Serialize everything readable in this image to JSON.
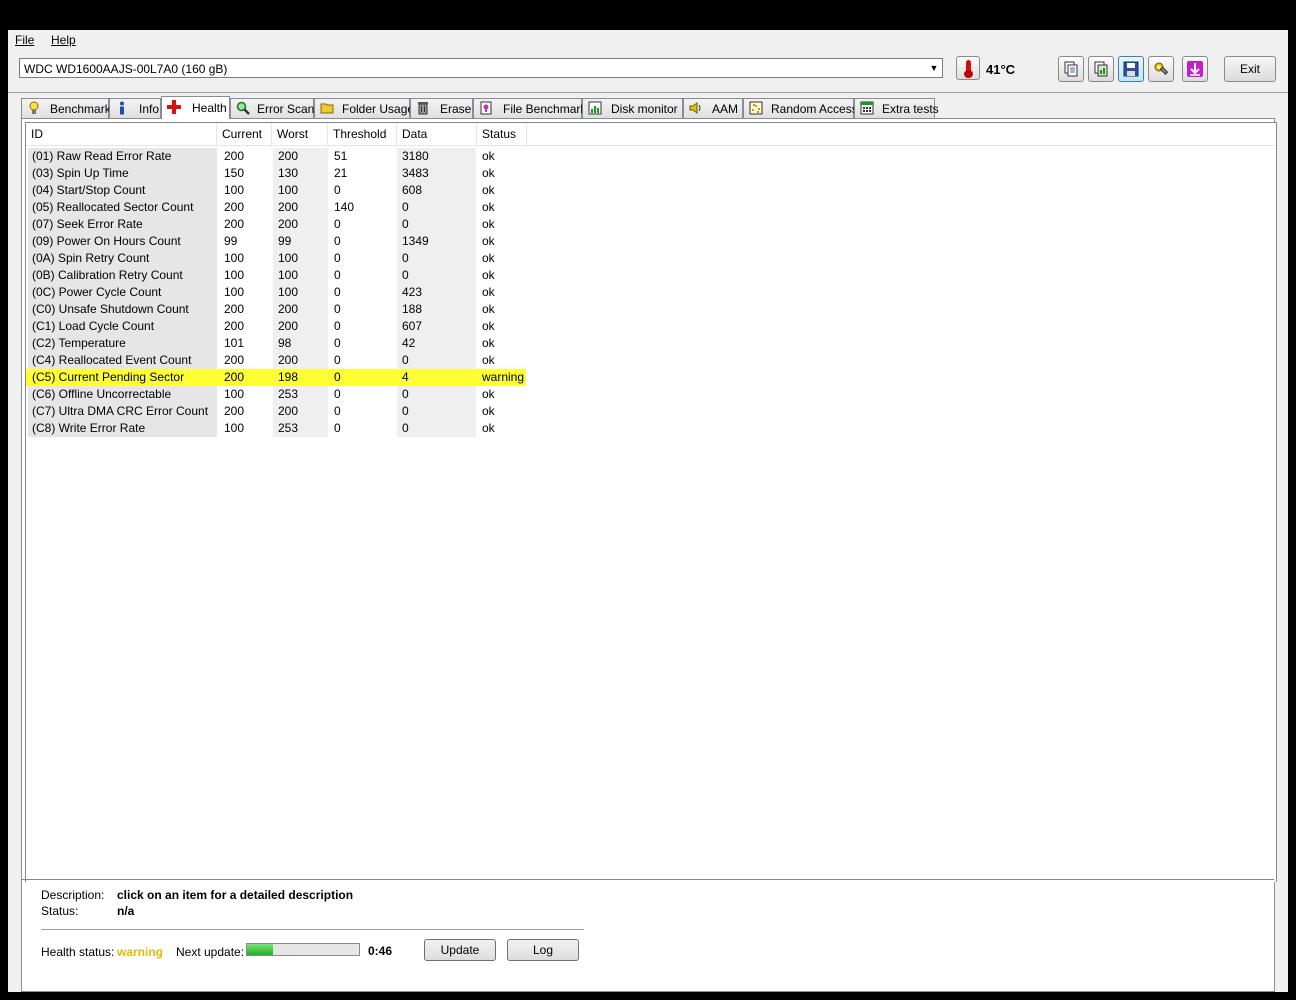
{
  "menu": {
    "file": "File",
    "help": "Help"
  },
  "toolbar": {
    "drive": "WDC WD1600AAJS-00L7A0 (160 gB)",
    "temperature": "41°C",
    "exit_label": "Exit"
  },
  "tabs": [
    {
      "label": "Benchmark",
      "icon": "lightbulb-icon"
    },
    {
      "label": "Info",
      "icon": "info-icon"
    },
    {
      "label": "Health",
      "icon": "red-cross-icon",
      "selected": true
    },
    {
      "label": "Error Scan",
      "icon": "magnifier-icon"
    },
    {
      "label": "Folder Usage",
      "icon": "folder-icon"
    },
    {
      "label": "Erase",
      "icon": "trash-icon"
    },
    {
      "label": "File Benchmark",
      "icon": "file-icon"
    },
    {
      "label": "Disk monitor",
      "icon": "monitor-chart-icon"
    },
    {
      "label": "AAM",
      "icon": "speaker-icon"
    },
    {
      "label": "Random Access",
      "icon": "scatter-icon"
    },
    {
      "label": "Extra tests",
      "icon": "calculator-icon"
    }
  ],
  "table": {
    "headers": [
      "ID",
      "Current",
      "Worst",
      "Threshold",
      "Data",
      "Status"
    ],
    "rows": [
      [
        "(01) Raw Read Error Rate",
        "200",
        "200",
        "51",
        "3180",
        "ok"
      ],
      [
        "(03) Spin Up Time",
        "150",
        "130",
        "21",
        "3483",
        "ok"
      ],
      [
        "(04) Start/Stop Count",
        "100",
        "100",
        "0",
        "608",
        "ok"
      ],
      [
        "(05) Reallocated Sector Count",
        "200",
        "200",
        "140",
        "0",
        "ok"
      ],
      [
        "(07) Seek Error Rate",
        "200",
        "200",
        "0",
        "0",
        "ok"
      ],
      [
        "(09) Power On Hours Count",
        "99",
        "99",
        "0",
        "1349",
        "ok"
      ],
      [
        "(0A) Spin Retry Count",
        "100",
        "100",
        "0",
        "0",
        "ok"
      ],
      [
        "(0B) Calibration Retry Count",
        "100",
        "100",
        "0",
        "0",
        "ok"
      ],
      [
        "(0C) Power Cycle Count",
        "100",
        "100",
        "0",
        "423",
        "ok"
      ],
      [
        "(C0) Unsafe Shutdown Count",
        "200",
        "200",
        "0",
        "188",
        "ok"
      ],
      [
        "(C1) Load Cycle Count",
        "200",
        "200",
        "0",
        "607",
        "ok"
      ],
      [
        "(C2) Temperature",
        "101",
        "98",
        "0",
        "42",
        "ok"
      ],
      [
        "(C4) Reallocated Event Count",
        "200",
        "200",
        "0",
        "0",
        "ok"
      ],
      [
        "(C5) Current Pending Sector",
        "200",
        "198",
        "0",
        "4",
        "warning"
      ],
      [
        "(C6) Offline Uncorrectable",
        "100",
        "253",
        "0",
        "0",
        "ok"
      ],
      [
        "(C7) Ultra DMA CRC Error Count",
        "200",
        "200",
        "0",
        "0",
        "ok"
      ],
      [
        "(C8) Write Error Rate",
        "100",
        "253",
        "0",
        "0",
        "ok"
      ]
    ],
    "warning_row_color": "#ffff33"
  },
  "details": {
    "description_label": "Description:",
    "description_value": "click on an item for a detailed description",
    "status_label": "Status:",
    "status_value": "n/a"
  },
  "health": {
    "label": "Health status:",
    "value": "warning",
    "value_color": "#e6b800",
    "next_update_label": "Next update:",
    "progress_fraction": 0.23,
    "countdown": "0:46",
    "update_button": "Update",
    "log_button": "Log"
  }
}
